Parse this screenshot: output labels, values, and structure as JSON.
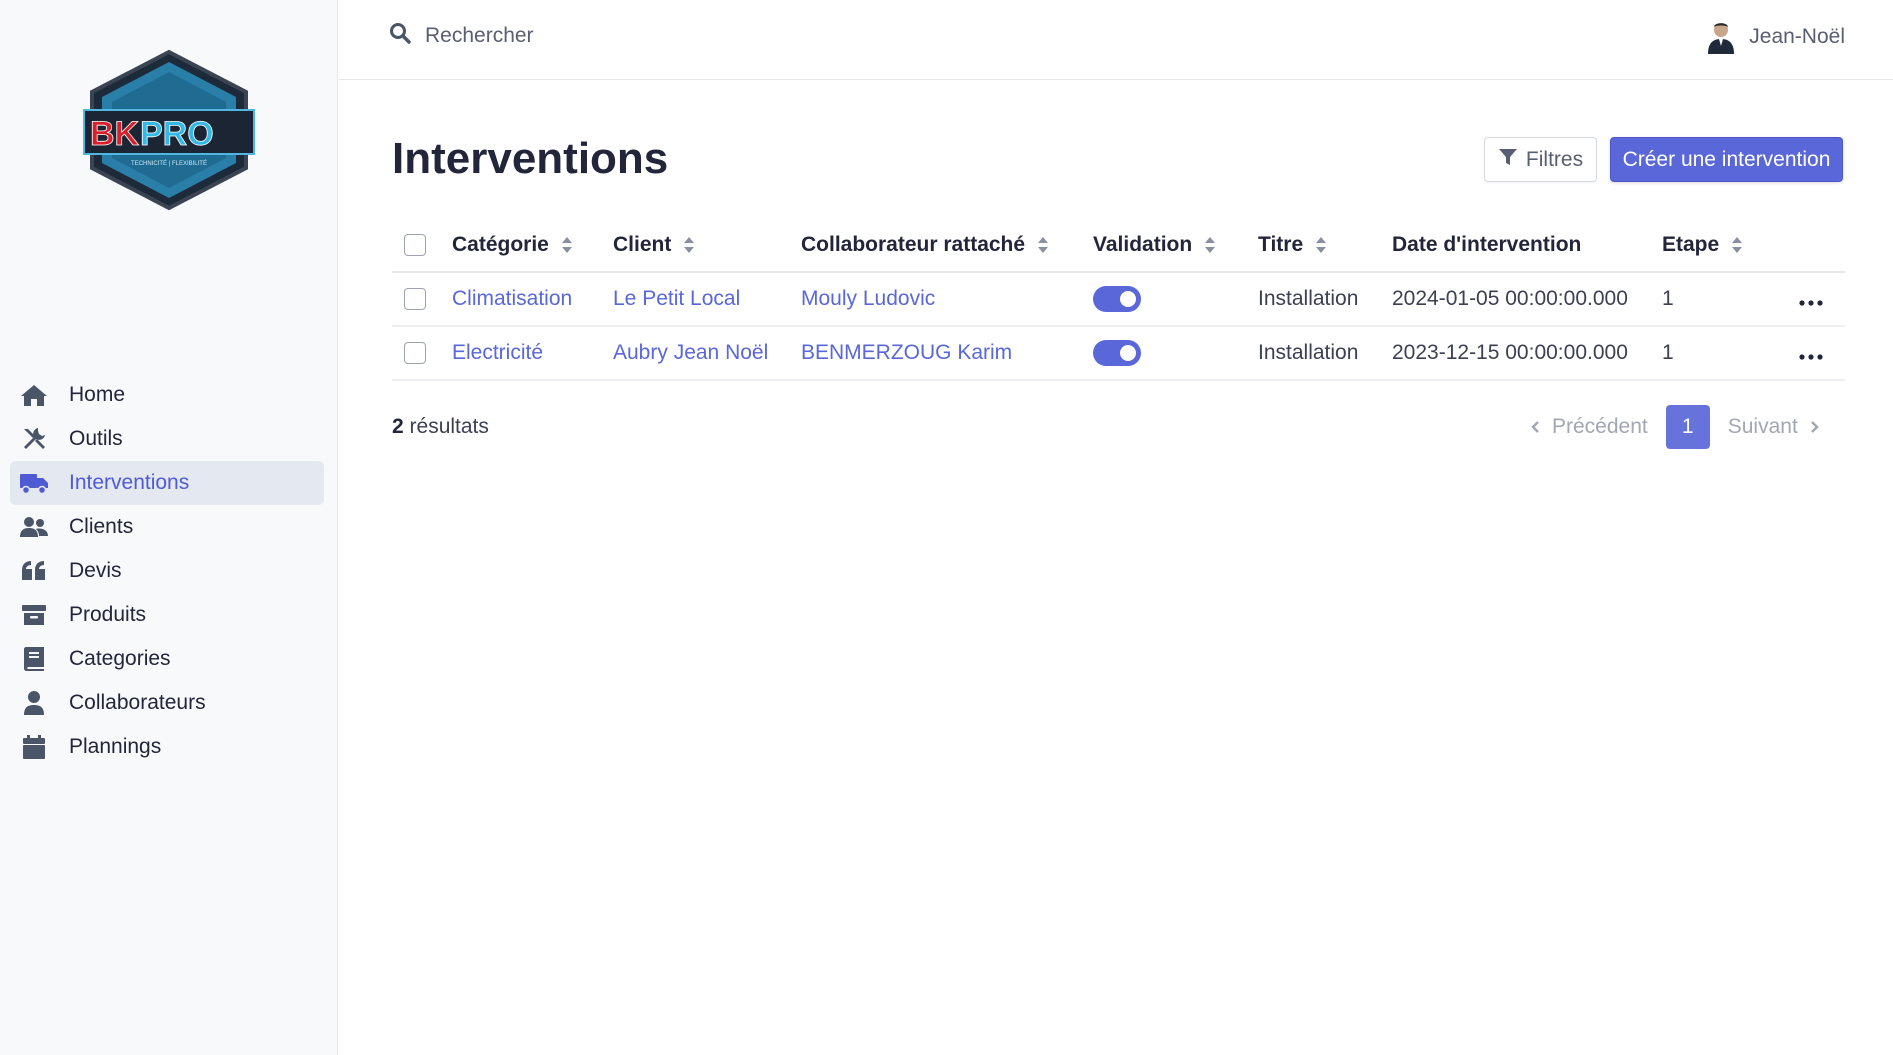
{
  "logo": {
    "text": "BKPRO",
    "tagline": "TECHNICITÉ | FLEXIBILITÉ"
  },
  "search": {
    "placeholder": "Rechercher"
  },
  "user": {
    "name": "Jean-Noël"
  },
  "sidebar": {
    "items": [
      {
        "label": "Home",
        "icon": "home-icon"
      },
      {
        "label": "Outils",
        "icon": "tools-icon"
      },
      {
        "label": "Interventions",
        "icon": "truck-icon",
        "active": true
      },
      {
        "label": "Clients",
        "icon": "users-icon"
      },
      {
        "label": "Devis",
        "icon": "quote-icon"
      },
      {
        "label": "Produits",
        "icon": "archive-icon"
      },
      {
        "label": "Categories",
        "icon": "book-icon"
      },
      {
        "label": "Collaborateurs",
        "icon": "user-icon"
      },
      {
        "label": "Plannings",
        "icon": "calendar-icon"
      }
    ]
  },
  "page": {
    "title": "Interventions",
    "filter_label": "Filtres",
    "create_label": "Créer une intervention"
  },
  "table": {
    "headers": [
      "Catégorie",
      "Client",
      "Collaborateur rattaché",
      "Validation",
      "Titre",
      "Date d'intervention",
      "Etape"
    ],
    "rows": [
      {
        "category": "Climatisation",
        "client": "Le Petit Local",
        "collaborator": "Mouly Ludovic",
        "validated": true,
        "title": "Installation",
        "date": "2024-01-05 00:00:00.000",
        "step": "1"
      },
      {
        "category": "Electricité",
        "client": "Aubry Jean Noël",
        "collaborator": "BENMERZOUG Karim",
        "validated": true,
        "title": "Installation",
        "date": "2023-12-15 00:00:00.000",
        "step": "1"
      }
    ]
  },
  "footer": {
    "count": "2",
    "count_suffix": " résultats",
    "prev_label": "Précédent",
    "next_label": "Suivant",
    "current_page": "1"
  },
  "colors": {
    "accent": "#5a67d8",
    "sidebar_active_bg": "#e4e8f1"
  }
}
